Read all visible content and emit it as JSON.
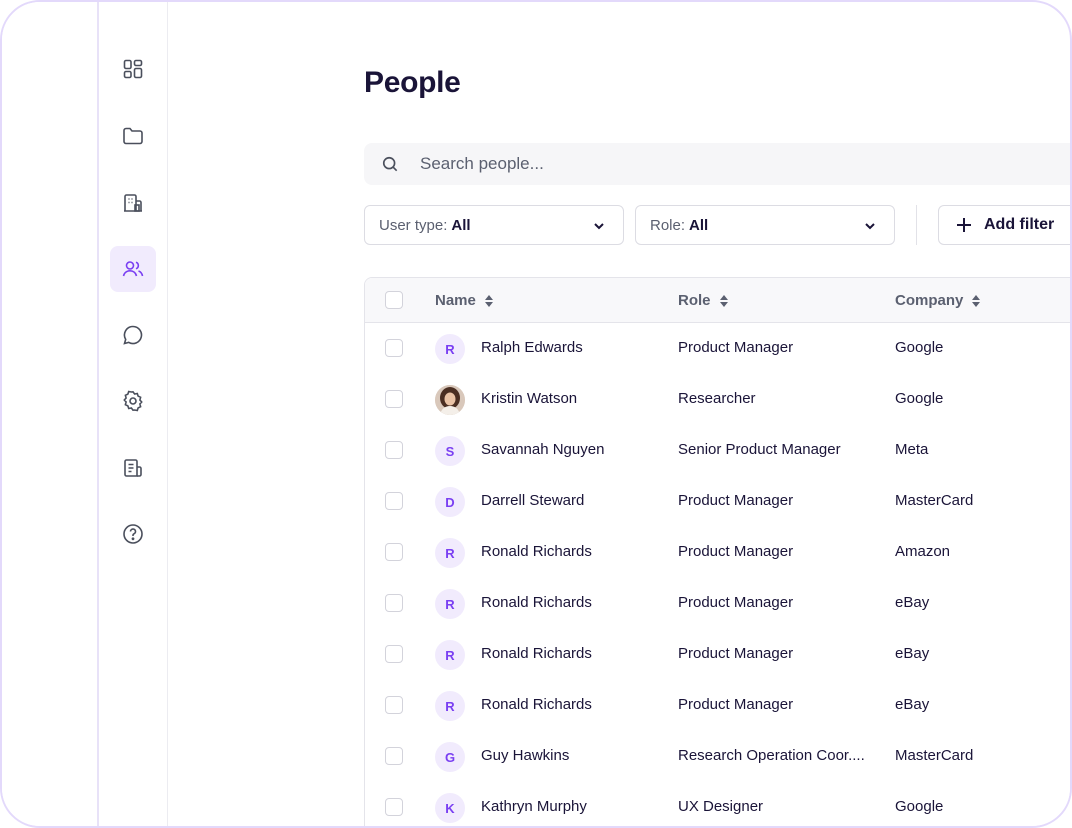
{
  "page": {
    "title": "People"
  },
  "search": {
    "placeholder": "Search people..."
  },
  "filters": {
    "user_type": {
      "label": "User type:",
      "value": "All"
    },
    "role": {
      "label": "Role:",
      "value": "All"
    },
    "add_filter_label": "Add filter"
  },
  "sidebar": {
    "items": [
      {
        "icon": "dashboard-icon",
        "active": false
      },
      {
        "icon": "folder-icon",
        "active": false
      },
      {
        "icon": "building-icon",
        "active": false
      },
      {
        "icon": "people-icon",
        "active": true
      },
      {
        "icon": "chat-icon",
        "active": false
      },
      {
        "icon": "gear-icon",
        "active": false
      },
      {
        "icon": "document-icon",
        "active": false
      },
      {
        "icon": "help-icon",
        "active": false
      }
    ]
  },
  "table": {
    "columns": {
      "name": "Name",
      "role": "Role",
      "company": "Company"
    },
    "rows": [
      {
        "initial": "R",
        "photo": false,
        "name": "Ralph Edwards",
        "role": "Product Manager",
        "company": "Google"
      },
      {
        "initial": "",
        "photo": true,
        "name": "Kristin Watson",
        "role": "Researcher",
        "company": "Google"
      },
      {
        "initial": "S",
        "photo": false,
        "name": "Savannah Nguyen",
        "role": "Senior Product Manager",
        "company": "Meta"
      },
      {
        "initial": "D",
        "photo": false,
        "name": "Darrell Steward",
        "role": "Product Manager",
        "company": "MasterCard"
      },
      {
        "initial": "R",
        "photo": false,
        "name": "Ronald Richards",
        "role": "Product Manager",
        "company": "Amazon"
      },
      {
        "initial": "R",
        "photo": false,
        "name": "Ronald Richards",
        "role": "Product Manager",
        "company": "eBay"
      },
      {
        "initial": "R",
        "photo": false,
        "name": "Ronald Richards",
        "role": "Product Manager",
        "company": "eBay"
      },
      {
        "initial": "R",
        "photo": false,
        "name": "Ronald Richards",
        "role": "Product Manager",
        "company": "eBay"
      },
      {
        "initial": "G",
        "photo": false,
        "name": "Guy Hawkins",
        "role": "Research Operation Coor....",
        "company": "MasterCard"
      },
      {
        "initial": "K",
        "photo": false,
        "name": "Kathryn Murphy",
        "role": "UX Designer",
        "company": "Google"
      }
    ]
  },
  "colors": {
    "accent": "#7a3ff2",
    "accent_bg": "#f1ebfd",
    "title": "#1a1438",
    "frame": "#e3d9fb"
  }
}
